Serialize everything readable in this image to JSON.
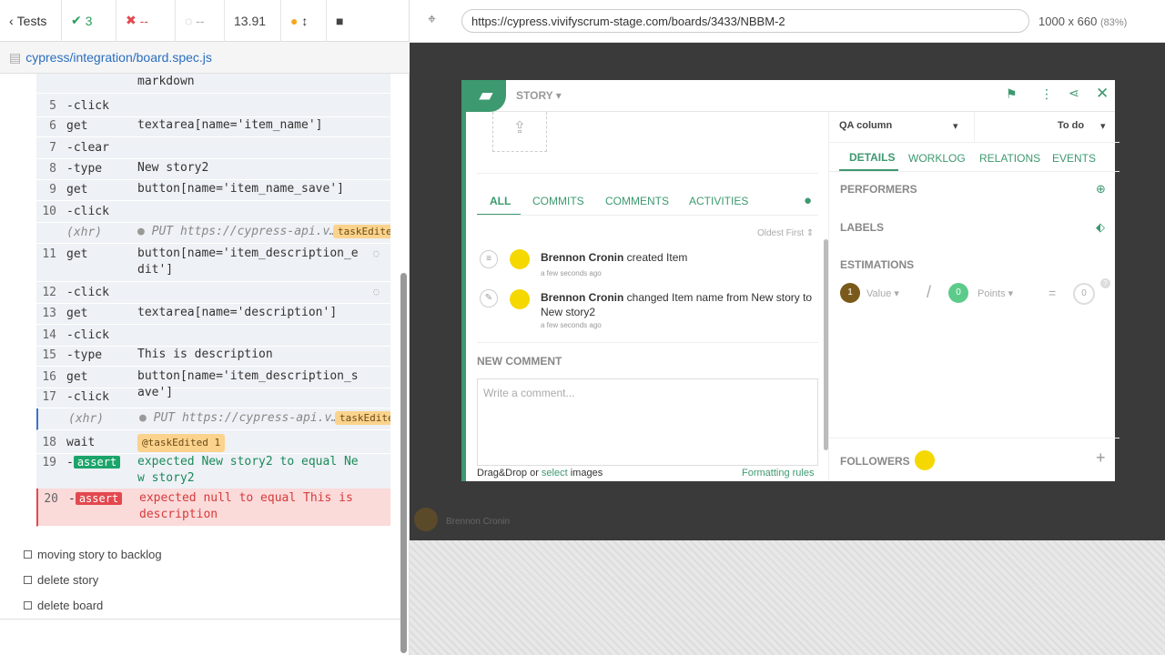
{
  "runner": {
    "back_label": "Tests",
    "passed": "3",
    "failed": "--",
    "pending": "--",
    "duration": "13.91",
    "spec_file": "cypress/integration/board.spec.js"
  },
  "commands": [
    {
      "arg": "markdown"
    },
    {
      "num": "5",
      "cmd": "-click",
      "arg": ""
    },
    {
      "num": "6",
      "cmd": "get",
      "arg": "textarea[name='item_name']"
    },
    {
      "num": "7",
      "cmd": "-clear",
      "arg": ""
    },
    {
      "num": "8",
      "cmd": "-type",
      "arg": "New story2"
    },
    {
      "num": "9",
      "cmd": "get",
      "arg": "button[name='item_name_save']"
    },
    {
      "num": "10",
      "cmd": "-click",
      "arg": ""
    },
    {
      "cmd": "(xhr)",
      "arg": "PUT https://cypress-api.v…",
      "tag": "taskEdited"
    },
    {
      "num": "11",
      "cmd": "get",
      "arg": "button[name='item_description_edit']"
    },
    {
      "num": "12",
      "cmd": "-click",
      "arg": ""
    },
    {
      "num": "13",
      "cmd": "get",
      "arg": "textarea[name='description']"
    },
    {
      "num": "14",
      "cmd": "-click",
      "arg": ""
    },
    {
      "num": "15",
      "cmd": "-type",
      "arg": "This is description"
    },
    {
      "num": "16",
      "cmd": "get",
      "arg": "button[name='item_description_save']"
    },
    {
      "num": "17",
      "cmd": "-click",
      "arg": ""
    },
    {
      "cmd": "(xhr)",
      "arg": "PUT https://cypress-api.v…",
      "tag": "taskEdited"
    },
    {
      "num": "18",
      "cmd": "wait",
      "arg": "@taskEdited 1"
    },
    {
      "num": "19",
      "cmd": "-assert",
      "arg": "expected New story2 to equal New story2"
    },
    {
      "num": "20",
      "cmd": "-assert",
      "arg": "expected null to equal This is description"
    }
  ],
  "tests": [
    "moving story to backlog",
    "delete story",
    "delete board"
  ],
  "browser": {
    "url": "https://cypress.vivifyscrum-stage.com/boards/3433/NBBM-2",
    "viewport": "1000 x 660",
    "zoom": "(83%)"
  },
  "modal": {
    "type": "STORY",
    "status_column": "QA column",
    "status": "To do",
    "activity_tabs": [
      "ALL",
      "COMMITS",
      "COMMENTS",
      "ACTIVITIES"
    ],
    "sort": "Oldest First",
    "activities": [
      {
        "user": "Brennon Cronin",
        "text": "created Item",
        "time": "a few seconds ago"
      },
      {
        "user": "Brennon Cronin",
        "text": "changed Item name from New story to New story2",
        "time": "a few seconds ago"
      }
    ],
    "new_comment_label": "NEW COMMENT",
    "comment_placeholder": "Write a comment...",
    "dragdrop": "Drag&Drop or",
    "select": "select",
    "images": "images",
    "formatting": "Formatting rules",
    "detail_tabs": [
      "DETAILS",
      "WORKLOG",
      "RELATIONS",
      "EVENTS"
    ],
    "performers": "PERFORMERS",
    "labels": "LABELS",
    "estimations": "ESTIMATIONS",
    "value_num": "1",
    "value_label": "Value",
    "points_num": "0",
    "points_label": "Points",
    "total": "0",
    "followers": "FOLLOWERS"
  },
  "app_footer_user": "Brennon Cronin"
}
